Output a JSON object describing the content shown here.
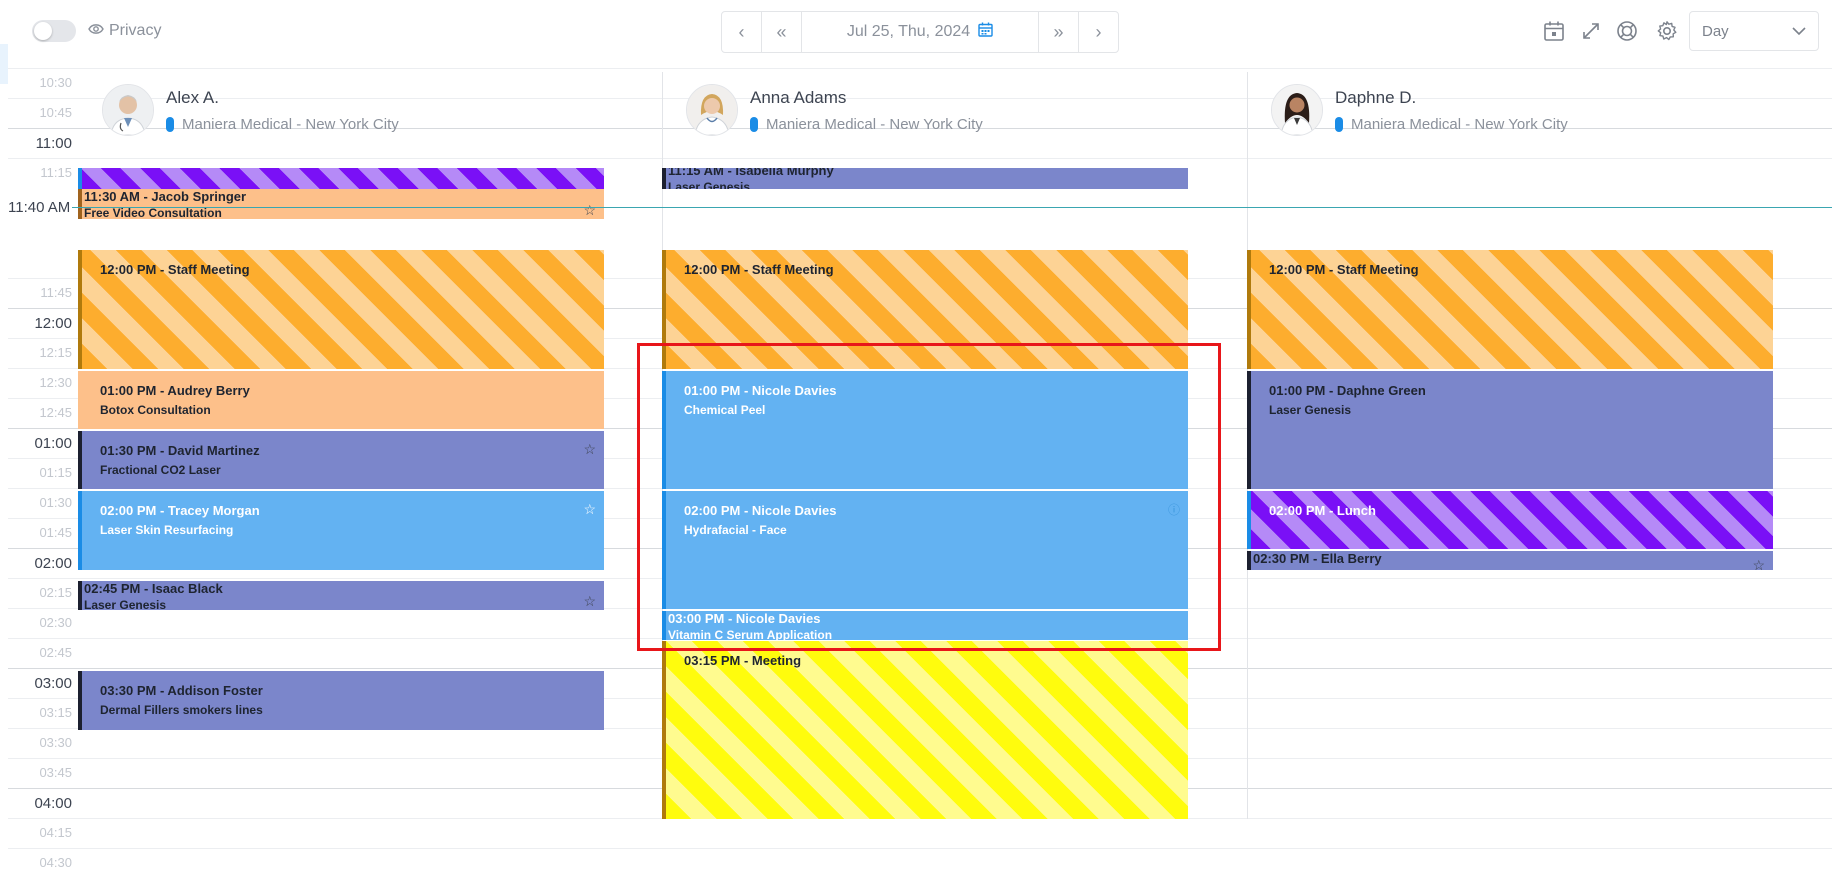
{
  "topbar": {
    "privacy_label": "Privacy",
    "date_label": "Jul 25, Thu, 2024",
    "view_select": "Day"
  },
  "icons": [
    "chevron-left-icon",
    "double-chevron-left-icon",
    "calendar-icon",
    "double-chevron-right-icon",
    "chevron-right-icon",
    "calendar-add-icon",
    "expand-icon",
    "lifebuoy-icon",
    "gear-icon",
    "chevron-down-icon",
    "eye-icon",
    "star-icon",
    "info-icon"
  ],
  "time_labels": [
    {
      "label": "10:30",
      "hour": false
    },
    {
      "label": "10:45",
      "hour": false
    },
    {
      "label": "11:00",
      "hour": true
    },
    {
      "label": "11:15",
      "hour": false
    },
    {
      "label": "11:45",
      "hour": false
    },
    {
      "label": "12:00",
      "hour": true
    },
    {
      "label": "12:15",
      "hour": false
    },
    {
      "label": "12:30",
      "hour": false
    },
    {
      "label": "12:45",
      "hour": false
    },
    {
      "label": "01:00",
      "hour": true
    },
    {
      "label": "01:15",
      "hour": false
    },
    {
      "label": "01:30",
      "hour": false
    },
    {
      "label": "01:45",
      "hour": false
    },
    {
      "label": "02:00",
      "hour": true
    },
    {
      "label": "02:15",
      "hour": false
    },
    {
      "label": "02:30",
      "hour": false
    },
    {
      "label": "02:45",
      "hour": false
    },
    {
      "label": "03:00",
      "hour": true
    },
    {
      "label": "03:15",
      "hour": false
    },
    {
      "label": "03:30",
      "hour": false
    },
    {
      "label": "03:45",
      "hour": false
    },
    {
      "label": "04:00",
      "hour": true
    },
    {
      "label": "04:15",
      "hour": false
    },
    {
      "label": "04:30",
      "hour": false
    }
  ],
  "now_indicator": "11:40 AM",
  "resources": [
    {
      "name": "Alex A.",
      "location": "Maniera Medical - New York City"
    },
    {
      "name": "Anna Adams",
      "location": "Maniera Medical - New York City"
    },
    {
      "name": "Daphne D.",
      "location": "Maniera Medical - New York City"
    }
  ],
  "events": [
    {
      "title": "",
      "subtitle": ""
    },
    {
      "title": "11:30 AM - Jacob Springer",
      "subtitle": "Free Video Consultation"
    },
    {
      "title": "12:00 PM - Staff Meeting",
      "subtitle": ""
    },
    {
      "title": "01:00 PM - Audrey Berry",
      "subtitle": "Botox Consultation"
    },
    {
      "title": "01:30 PM - David Martinez",
      "subtitle": "Fractional CO2 Laser"
    },
    {
      "title": "02:00 PM - Tracey Morgan",
      "subtitle": "Laser Skin Resurfacing"
    },
    {
      "title": "02:45 PM - Isaac Black",
      "subtitle": "Laser Genesis"
    },
    {
      "title": "03:30 PM - Addison Foster",
      "subtitle": "Dermal Fillers smokers lines"
    },
    {
      "title": "11:15 AM - Isabella Murphy",
      "subtitle": "Laser Genesis"
    },
    {
      "title": "12:00 PM - Staff Meeting",
      "subtitle": ""
    },
    {
      "title": "01:00 PM - Nicole Davies",
      "subtitle": "Chemical Peel"
    },
    {
      "title": "02:00 PM - Nicole Davies",
      "subtitle": "Hydrafacial - Face"
    },
    {
      "title": "03:00 PM - Nicole Davies",
      "subtitle": "Vitamin C Serum Application"
    },
    {
      "title": "03:15 PM - Meeting",
      "subtitle": ""
    },
    {
      "title": "12:00 PM - Staff Meeting",
      "subtitle": ""
    },
    {
      "title": "01:00 PM - Daphne Green",
      "subtitle": "Laser Genesis"
    },
    {
      "title": "02:00 PM - Lunch",
      "subtitle": ""
    },
    {
      "title": "02:30 PM - Ella Berry",
      "subtitle": ""
    }
  ]
}
